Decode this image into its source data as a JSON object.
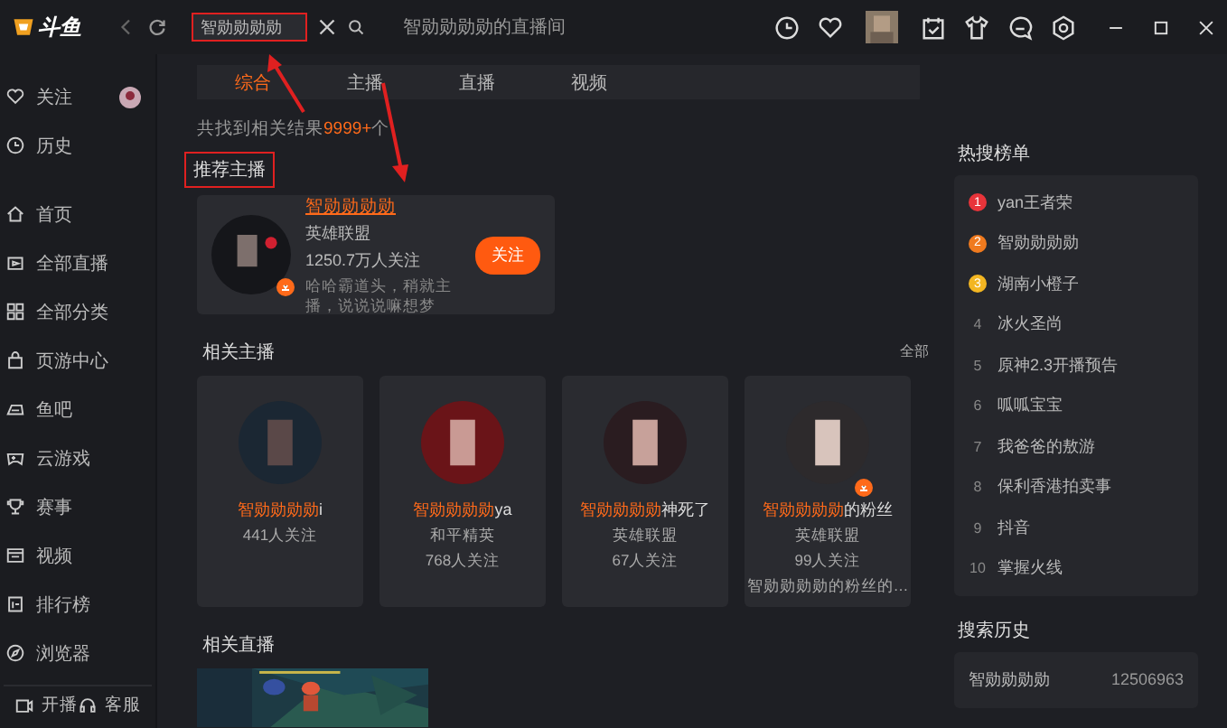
{
  "top_bar": {
    "logo": "斗鱼",
    "search": {
      "value": "智勋勋勋勋",
      "highlighted": true
    },
    "tab": {
      "title": "智勋勋勋勋的直播间"
    }
  },
  "sidebar": {
    "items": [
      {
        "label": "关注"
      },
      {
        "label": "历史"
      },
      {
        "label": "首页"
      },
      {
        "label": "全部直播"
      },
      {
        "label": "全部分类"
      },
      {
        "label": "页游中心"
      },
      {
        "label": "鱼吧"
      },
      {
        "label": "云游戏"
      },
      {
        "label": "赛事"
      },
      {
        "label": "视频"
      },
      {
        "label": "排行榜"
      },
      {
        "label": "浏览器"
      }
    ],
    "bottom": [
      {
        "label": "开播"
      },
      {
        "label": "客服"
      }
    ]
  },
  "tabs": [
    {
      "label": "综合",
      "selected": true
    },
    {
      "label": "主播",
      "selected": false
    },
    {
      "label": "直播",
      "selected": false
    },
    {
      "label": "视频",
      "selected": false
    }
  ],
  "result_count": "共找到相关结果**9999+**个",
  "recommended": {
    "title": "推荐主播",
    "highlighted": true,
    "name": "智勋勋勋勋",
    "category": "英雄联盟",
    "followers": "1250.7万人关注",
    "description": "哈哈霸道头，稍就主播，说说说嘛想梦",
    "live": true,
    "follow_button": "关注"
  },
  "related_streamers": {
    "title": "相关主播",
    "more": "全部",
    "items": [
      {
        "name": "**智勋勋勋勋**i",
        "lines": [
          "441人关注"
        ],
        "live": false
      },
      {
        "name": "**智勋勋勋勋**ya",
        "lines": [
          "和平精英",
          "768人关注"
        ],
        "live": false
      },
      {
        "name": "**智勋勋勋勋**神死了",
        "lines": [
          "英雄联盟",
          "67人关注"
        ],
        "live": false
      },
      {
        "name": "**智勋勋勋勋**的粉丝",
        "lines": [
          "英雄联盟",
          "99人关注",
          "智勋勋勋勋的粉丝的…"
        ],
        "live": true
      }
    ]
  },
  "related_live": {
    "title": "相关直播",
    "kind": "picture"
  },
  "hot_list": {
    "title": "热搜榜单",
    "items": [
      {
        "rank": "1",
        "label": "yan王者荣",
        "kind": "badge",
        "color": "#e8343a"
      },
      {
        "rank": "2",
        "label": "智勋勋勋勋",
        "kind": "badge",
        "color": "#f07a1e"
      },
      {
        "rank": "3",
        "label": "湖南小橙子",
        "kind": "badge",
        "color": "#f3b622"
      },
      {
        "rank": "4",
        "label": "冰火圣尚",
        "kind": "plain"
      },
      {
        "rank": "5",
        "label": "原神2.3开播预告",
        "kind": "plain"
      },
      {
        "rank": "6",
        "label": "呱呱宝宝",
        "kind": "plain"
      },
      {
        "rank": "7",
        "label": "我爸爸的敖游",
        "kind": "plain"
      },
      {
        "rank": "8",
        "label": "保利香港拍卖事",
        "kind": "plain"
      },
      {
        "rank": "9",
        "label": "抖音",
        "kind": "plain"
      },
      {
        "rank": "10",
        "label": "掌握火线",
        "kind": "plain"
      }
    ]
  },
  "search_history": {
    "title": "搜索历史",
    "items": [
      {
        "label": "智勋勋勋勋",
        "count": "12506963"
      }
    ]
  }
}
